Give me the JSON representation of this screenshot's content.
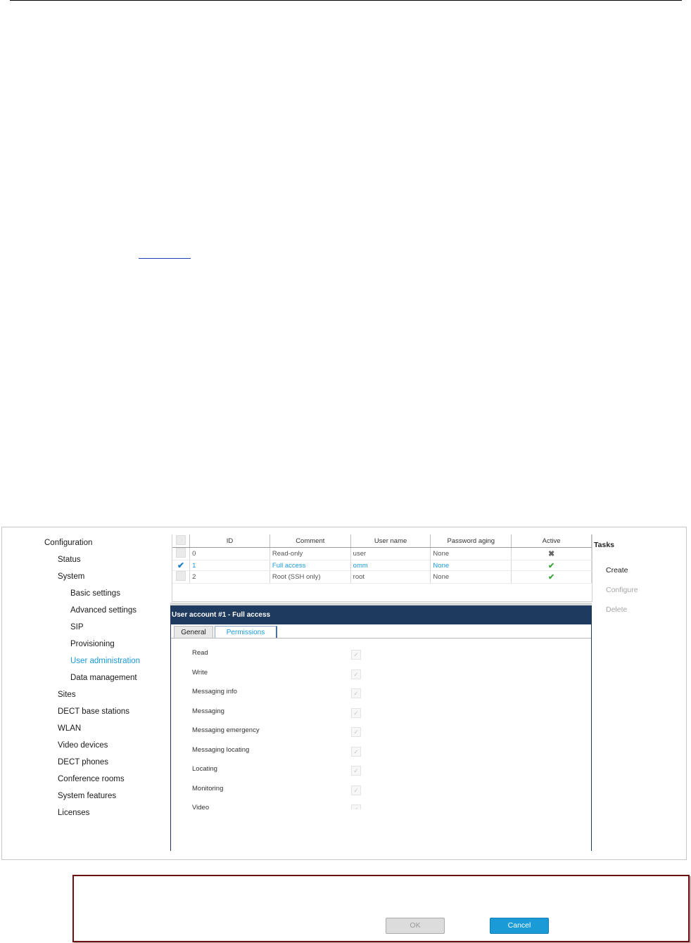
{
  "nav": {
    "items": [
      {
        "label": "Configuration",
        "level": 0
      },
      {
        "label": "Status",
        "level": 1
      },
      {
        "label": "System",
        "level": 1
      },
      {
        "label": "Basic settings",
        "level": 2
      },
      {
        "label": "Advanced settings",
        "level": 2
      },
      {
        "label": "SIP",
        "level": 2
      },
      {
        "label": "Provisioning",
        "level": 2
      },
      {
        "label": "User administration",
        "level": 2,
        "active": true
      },
      {
        "label": "Data management",
        "level": 2
      },
      {
        "label": "Sites",
        "level": 1
      },
      {
        "label": "DECT base stations",
        "level": 1
      },
      {
        "label": "WLAN",
        "level": 1
      },
      {
        "label": "Video devices",
        "level": 1
      },
      {
        "label": "DECT phones",
        "level": 1
      },
      {
        "label": "Conference rooms",
        "level": 1
      },
      {
        "label": "System features",
        "level": 1
      },
      {
        "label": "Licenses",
        "level": 1
      }
    ]
  },
  "grid": {
    "headers": [
      "ID",
      "Comment",
      "User name",
      "Password aging",
      "Active"
    ],
    "rows": [
      {
        "id": "0",
        "comment": "Read-only",
        "user": "user",
        "aging": "None",
        "active": false,
        "selected": false
      },
      {
        "id": "1",
        "comment": "Full access",
        "user": "omm",
        "aging": "None",
        "active": true,
        "selected": true
      },
      {
        "id": "2",
        "comment": "Root (SSH only)",
        "user": "root",
        "aging": "None",
        "active": true,
        "selected": false
      }
    ]
  },
  "detail": {
    "title": "User account #1 - Full access",
    "tabs": [
      "General",
      "Permissions"
    ],
    "active_tab": "Permissions",
    "permissions": [
      {
        "label": "Read",
        "checked": true
      },
      {
        "label": "Write",
        "checked": true
      },
      {
        "label": "Messaging info",
        "checked": true
      },
      {
        "label": "Messaging",
        "checked": true
      },
      {
        "label": "Messaging emergency",
        "checked": true
      },
      {
        "label": "Messaging locating",
        "checked": true
      },
      {
        "label": "Locating",
        "checked": true
      },
      {
        "label": "Monitoring",
        "checked": true
      },
      {
        "label": "Video",
        "checked": true
      }
    ],
    "ok_label": "OK",
    "cancel_label": "Cancel"
  },
  "tasks": {
    "title": "Tasks",
    "items": [
      {
        "label": "Create",
        "enabled": true
      },
      {
        "label": "Configure",
        "enabled": false
      },
      {
        "label": "Delete",
        "enabled": false
      }
    ]
  },
  "colors": {
    "accent": "#1a9ad6",
    "header_bar": "#1f3a5f",
    "active_check": "#3aa83a",
    "callout_border": "#6b0f0f"
  }
}
